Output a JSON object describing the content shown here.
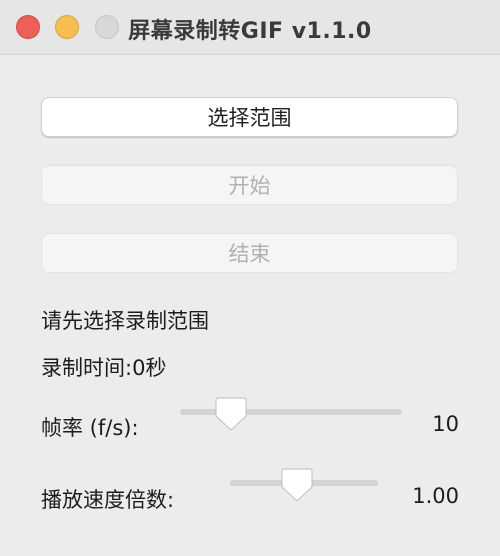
{
  "window": {
    "title": "屏幕录制转GIF v1.1.0"
  },
  "buttons": {
    "select_range": "选择范围",
    "start": "开始",
    "stop": "结束"
  },
  "status": {
    "message": "请先选择录制范围",
    "record_time_label": "录制时间:",
    "record_time_value": "0秒"
  },
  "frame_rate": {
    "label": "帧率 (f/s):",
    "value": "10",
    "slider_fraction": 0.23
  },
  "playback_speed": {
    "label": "播放速度倍数:",
    "value": "1.00",
    "slider_fraction": 0.45
  },
  "colors": {
    "close": "#ee5f57",
    "minimize": "#f6be4f",
    "zoom_disabled": "#d8d8d8"
  }
}
